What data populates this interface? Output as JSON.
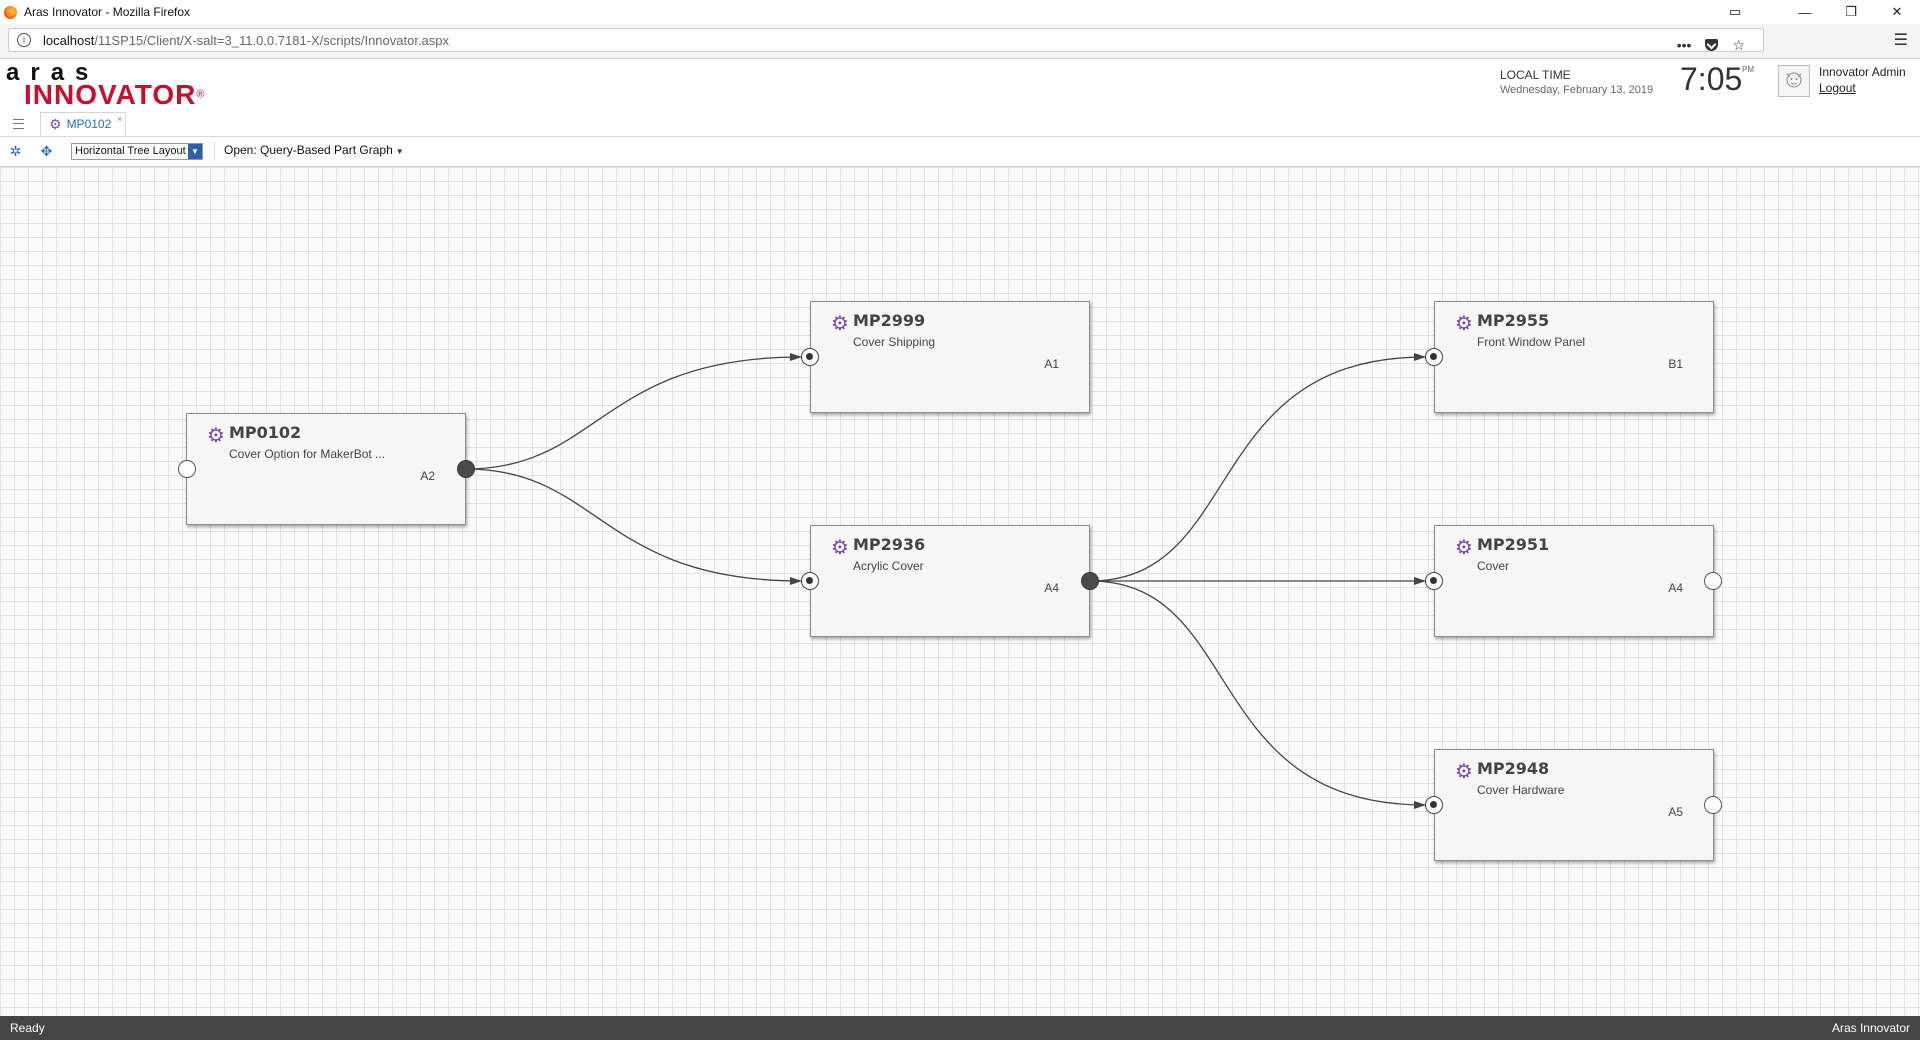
{
  "window": {
    "title": "Aras Innovator - Mozilla Firefox",
    "minimize": "—",
    "restore": "❐",
    "close": "✕",
    "extra": "▭"
  },
  "address": {
    "host": "localhost",
    "path": "/11SP15/Client/X-salt=3_11.0.0.7181-X/scripts/Innovator.aspx",
    "more": "•••",
    "star": "☆",
    "menu": "☰"
  },
  "header": {
    "logo_top": "aras",
    "logo_bottom": "INNOVATOR",
    "logo_reg": "®",
    "local_time_label": "LOCAL TIME",
    "date": "Wednesday, February 13, 2019",
    "time": "7:05",
    "ampm": "PM",
    "user_name": "Innovator Admin",
    "logout": "Logout"
  },
  "tabs": [
    {
      "label": "MP0102",
      "close": "×"
    }
  ],
  "graph_toolbar": {
    "layout_value": "Horizontal Tree Layout",
    "layout_arrow": "▼",
    "open_label": "Open: Query-Based Part Graph",
    "open_caret": "▼",
    "fit_icon": "✲",
    "center_icon": "✥"
  },
  "nodes": [
    {
      "id": "MP0102",
      "name": "Cover Option for MakerBot ...",
      "rev": "A2"
    },
    {
      "id": "MP2999",
      "name": "Cover Shipping",
      "rev": "A1"
    },
    {
      "id": "MP2936",
      "name": "Acrylic Cover",
      "rev": "A4"
    },
    {
      "id": "MP2955",
      "name": "Front Window Panel",
      "rev": "B1"
    },
    {
      "id": "MP2951",
      "name": "Cover",
      "rev": "A4"
    },
    {
      "id": "MP2948",
      "name": "Cover Hardware",
      "rev": "A5"
    }
  ],
  "icons": {
    "part_icon": "⚙",
    "gear_icon": "⚙"
  },
  "colors": {
    "accent_blue": "#2b6fb6",
    "brand_red": "#c8102e",
    "part_icon_purple": "#7b4fa1",
    "status_bar": "#454545"
  },
  "status": {
    "left": "Ready",
    "right": "Aras Innovator"
  }
}
